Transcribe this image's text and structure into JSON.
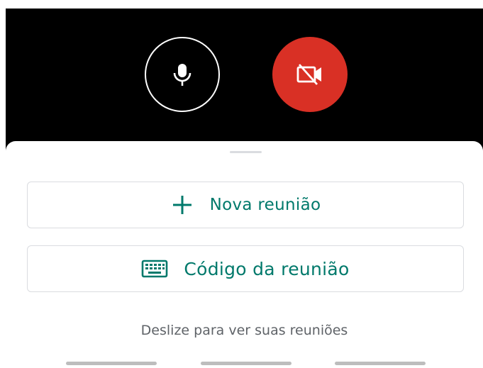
{
  "camera_preview": {
    "microphone_button": {
      "icon": "mic-icon",
      "state": "on"
    },
    "camera_button": {
      "icon": "videocam-off-icon",
      "state": "off",
      "color": "#d93025"
    }
  },
  "sheet": {
    "new_meeting": {
      "icon": "plus-icon",
      "label": "Nova reunião"
    },
    "meeting_code": {
      "icon": "keyboard-icon",
      "label": "Código da reunião"
    },
    "hint": "Deslize para ver suas reuniões"
  },
  "colors": {
    "accent": "#00796b",
    "danger": "#d93025",
    "background_dark": "#000000",
    "hint_text": "#5f6368"
  }
}
